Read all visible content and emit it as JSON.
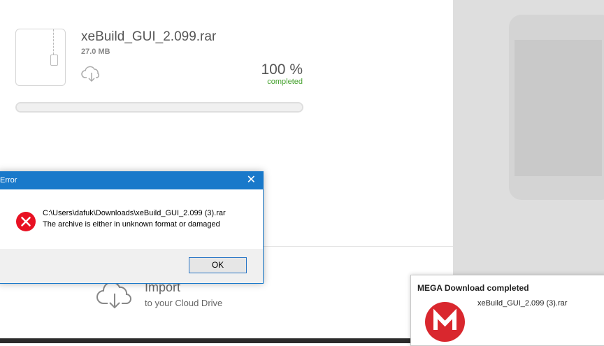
{
  "download": {
    "file_name": "xeBuild_GUI_2.099.rar",
    "file_size": "27.0 MB",
    "progress_percent": "100 %",
    "progress_status": "completed",
    "progress_fraction": 1.0,
    "icons": {
      "file": "zip-file-icon",
      "cloud": "cloud-download-icon"
    }
  },
  "import": {
    "title": "Import",
    "subtitle": "to your Cloud Drive",
    "icon": "cloud-upload-icon"
  },
  "error_dialog": {
    "title": "Error",
    "close_glyph": "✕",
    "path": "C:\\Users\\dafuk\\Downloads\\xeBuild_GUI_2.099 (3).rar",
    "message": "The archive is either in unknown format or damaged",
    "ok_label": "OK",
    "icon": "error-icon"
  },
  "toast": {
    "title": "MEGA Download completed",
    "file_name": "xeBuild_GUI_2.099 (3).rar",
    "icon": "mega-logo-icon"
  },
  "colors": {
    "accent_blue": "#1979ca",
    "success_green": "#43a02b",
    "error_red": "#e81123",
    "mega_red": "#d9272e"
  }
}
